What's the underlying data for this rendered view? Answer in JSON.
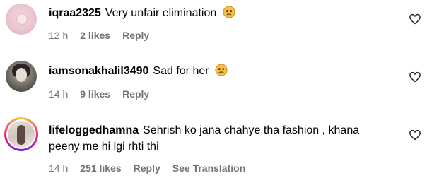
{
  "comments": [
    {
      "username": "iqraa2325",
      "text": "Very unfair elimination",
      "emoji": "sad-face-emoji",
      "time": "12 h",
      "likes": "2 likes",
      "reply": "Reply"
    },
    {
      "username": "iamsonakhalil3490",
      "text": "Sad for her",
      "emoji": "sad-face-emoji",
      "time": "14 h",
      "likes": "9 likes",
      "reply": "Reply"
    },
    {
      "username": "lifeloggedhamna",
      "text_line1": "Sehrish ko jana chahye tha fashion , khana",
      "text_line2": "peeny me hi lgi rhti thi",
      "time": "14 h",
      "likes": "251 likes",
      "reply": "Reply",
      "translation": "See Translation"
    }
  ],
  "icons": {
    "like": "heart-outline-icon"
  }
}
